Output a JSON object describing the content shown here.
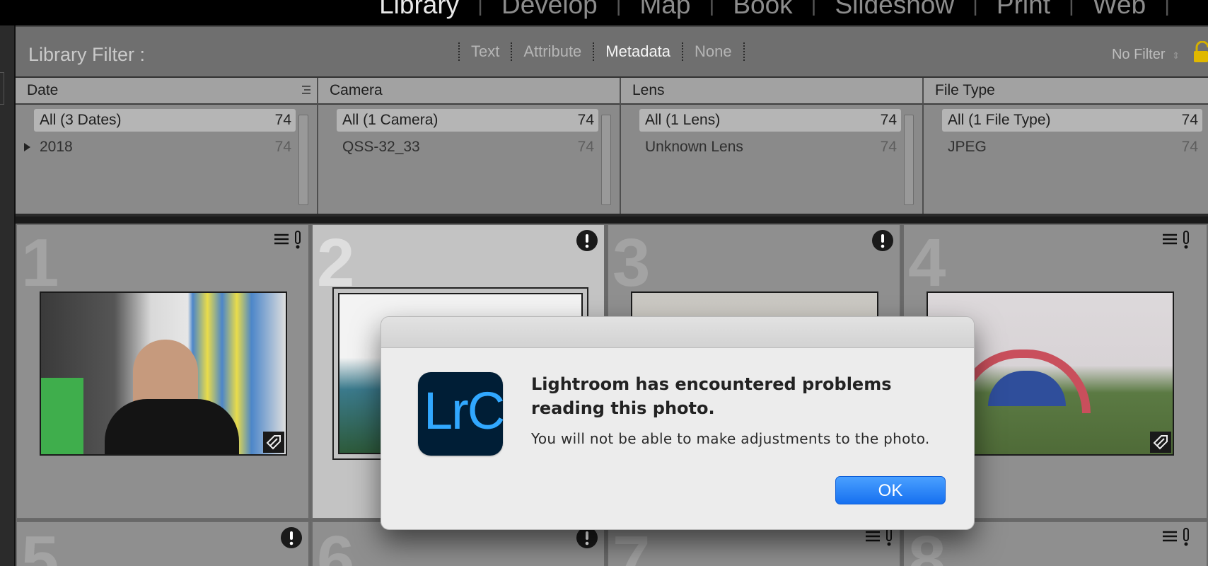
{
  "topbar": {
    "modules": [
      "Library",
      "Develop",
      "Map",
      "Book",
      "Slideshow",
      "Print",
      "Web"
    ],
    "active_module": "Library"
  },
  "filter_bar": {
    "title": "Library Filter :",
    "tabs": [
      "Text",
      "Attribute",
      "Metadata",
      "None"
    ],
    "active_tab": "Metadata",
    "preset": "No Filter"
  },
  "metadata_browser": {
    "columns": [
      {
        "header": "Date",
        "rows": [
          {
            "label": "All (3 Dates)",
            "count": "74"
          },
          {
            "label": "2018",
            "count": "74"
          }
        ]
      },
      {
        "header": "Camera",
        "rows": [
          {
            "label": "All (1 Camera)",
            "count": "74"
          },
          {
            "label": "QSS-32_33",
            "count": "74"
          }
        ]
      },
      {
        "header": "Lens",
        "rows": [
          {
            "label": "All (1 Lens)",
            "count": "74"
          },
          {
            "label": "Unknown Lens",
            "count": "74"
          }
        ]
      },
      {
        "header": "File Type",
        "rows": [
          {
            "label": "All (1 File Type)",
            "count": "74"
          },
          {
            "label": "JPEG",
            "count": "74"
          }
        ]
      }
    ]
  },
  "grid": {
    "cells": [
      {
        "index": "1",
        "status_icon": "metadata-icon"
      },
      {
        "index": "2",
        "status_icon": "warning-icon"
      },
      {
        "index": "3",
        "status_icon": "warning-icon"
      },
      {
        "index": "4",
        "status_icon": "metadata-icon"
      },
      {
        "index": "5",
        "status_icon": "warning-icon"
      },
      {
        "index": "6",
        "status_icon": "warning-icon"
      },
      {
        "index": "7",
        "status_icon": "metadata-icon"
      },
      {
        "index": "8",
        "status_icon": "metadata-icon"
      }
    ],
    "selected_index": "2"
  },
  "dialog": {
    "app_icon_text": "LrC",
    "title": "Lightroom has encountered problems reading this photo.",
    "message": "You will not be able to make adjustments to the photo.",
    "ok_label": "OK"
  },
  "colors": {
    "accent_button": "#1670f0",
    "app_icon_bg": "#001e36",
    "app_icon_fg": "#31a8ff"
  }
}
